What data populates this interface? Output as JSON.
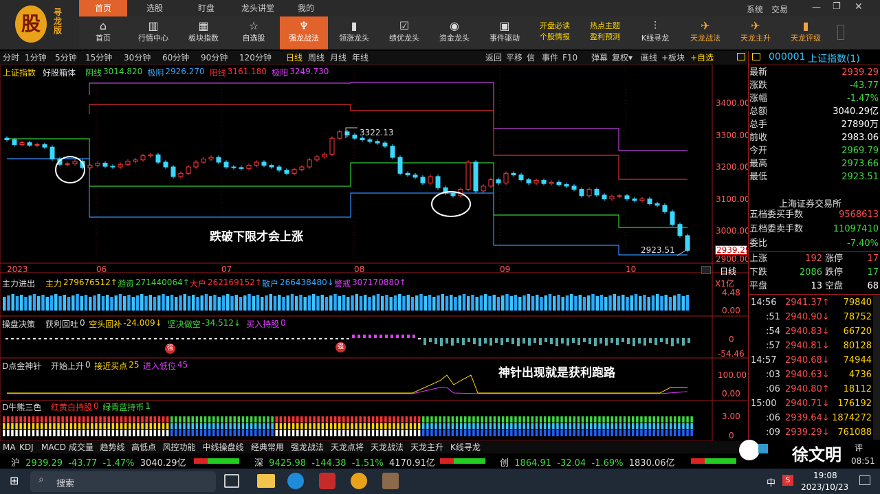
{
  "app": {
    "logo_char": "股",
    "logo_text": "寻龙版",
    "top_nav": [
      "首页",
      "选股",
      "盯盘",
      "龙头讲堂",
      "我的"
    ],
    "top_nav_active": 0,
    "top_right": [
      "系统",
      "交易"
    ],
    "window_controls": [
      "minimize-icon",
      "restore-icon",
      "close-icon"
    ]
  },
  "toolbar": {
    "buttons": [
      {
        "label": "首页",
        "icon": "home-icon"
      },
      {
        "label": "行情中心",
        "icon": "chart-icon"
      },
      {
        "label": "板块指数",
        "icon": "grid-icon"
      },
      {
        "label": "自选股",
        "icon": "star-icon"
      },
      {
        "label": "强龙战法",
        "icon": "dragon-icon",
        "active": true
      },
      {
        "label": "领涨龙头",
        "icon": "bar-icon"
      },
      {
        "label": "绩优龙头",
        "icon": "check-icon"
      },
      {
        "label": "资金龙头",
        "icon": "coin-icon"
      },
      {
        "label": "事件驱动",
        "icon": "event-icon"
      },
      {
        "label_top": "开盘必读",
        "label": "个股情报"
      },
      {
        "label_top": "热点主题",
        "label": "盈利预测"
      },
      {
        "label": "K线寻龙",
        "icon": "kline-icon"
      },
      {
        "label": "天龙战法",
        "icon": "jet-icon",
        "orange": true
      },
      {
        "label": "天龙主升",
        "icon": "jet-icon",
        "orange": true
      },
      {
        "label": "天龙评级",
        "icon": "bar-icon",
        "orange": true
      }
    ]
  },
  "periods": [
    "分时",
    "1分钟",
    "5分钟",
    "15分钟",
    "30分钟",
    "60分钟",
    "90分钟",
    "120分钟",
    "日线",
    "周线",
    "月线",
    "年线"
  ],
  "period_active": "日线",
  "ktools": [
    "返回",
    "平移",
    "信",
    "事件",
    "F10",
    "弹幕",
    "复权▾",
    "画线",
    "+板块",
    "+自选"
  ],
  "main_chart": {
    "title": "上证指数",
    "indicator": "好股箱体",
    "legend": [
      {
        "name": "阴线",
        "value": "3014.820",
        "color": "#3fd83f"
      },
      {
        "name": "极阴",
        "value": "2926.270",
        "color": "#35a8ff"
      },
      {
        "name": "阳线",
        "value": "3161.180",
        "color": "#ff3030"
      },
      {
        "name": "极阳",
        "value": "3249.730",
        "color": "#e03cff"
      }
    ],
    "y_ticks": [
      "3400.00",
      "3300.00",
      "3200.00",
      "3100.00",
      "3000.00"
    ],
    "price_tag": "2939.29",
    "price_tag_low": "2900.00",
    "high_label": "3322.13",
    "low_label": "2923.51",
    "x_labels": [
      "2023",
      "06",
      "07",
      "08",
      "09",
      "10"
    ],
    "annotation": "跌破下限才会上涨",
    "period_tag": "日线"
  },
  "panel_fund": {
    "title": "主力进出",
    "items": [
      {
        "name": "主力",
        "value": "279676512↑",
        "color": "#ffd400"
      },
      {
        "name": "游资",
        "value": "271440064↑",
        "color": "#3fd83f"
      },
      {
        "name": "大户",
        "value": "262169152↑",
        "color": "#ff3030"
      },
      {
        "name": "散户",
        "value": "266438480↓",
        "color": "#35a8ff"
      },
      {
        "name": "警戒",
        "value": "307170880↑",
        "color": "#e03cff"
      }
    ],
    "unit": "X1亿",
    "y_ticks": [
      "4.48",
      "0.00"
    ]
  },
  "panel_ops": {
    "title": "操盘决策",
    "items": [
      {
        "name": "获利回吐",
        "value": "0",
        "color": "#dddddd"
      },
      {
        "name": "空头回补",
        "value": "-24.009↓",
        "color": "#ffd400"
      },
      {
        "name": "坚决做空",
        "value": "-34.512↓",
        "color": "#3fd83f"
      },
      {
        "name": "买入持股",
        "value": "0",
        "color": "#e03cff"
      }
    ],
    "y_ticks": [
      "0",
      "-54.46"
    ],
    "badge": "强"
  },
  "panel_needle": {
    "title": "D点金神针",
    "items": [
      {
        "name": "开始上升",
        "value": "0",
        "color": "#dddddd"
      },
      {
        "name": "接近买点",
        "value": "25",
        "color": "#ffd400"
      },
      {
        "name": "进入低位",
        "value": "45",
        "color": "#e03cff"
      }
    ],
    "y_ticks": [
      "100.00",
      "0.00"
    ],
    "annotation": "神针出现就是获利跑路"
  },
  "panel_bull": {
    "title": "D牛熊三色",
    "items": [
      {
        "name": "红黄白持股",
        "value": "0",
        "color": "#ff3030"
      },
      {
        "name": "绿青蓝持币",
        "value": "1",
        "color": "#3fd83f"
      }
    ],
    "y_ticks": [
      "3.00",
      "0"
    ]
  },
  "bottom_tabs": [
    "MA",
    "KDJ",
    "MACD",
    "成交量",
    "趋势线",
    "高低点",
    "风控功能",
    "中线操盘线",
    "经典常用",
    "强龙战法",
    "天龙点将",
    "天龙战法",
    "天龙主升",
    "K线寻龙"
  ],
  "right_panel": {
    "code": "000001",
    "name": "上证指数(1)",
    "rows": [
      {
        "k": "最新",
        "v": "2939.29",
        "c": "#ff4d4d"
      },
      {
        "k": "涨跌",
        "v": "-43.77",
        "c": "#3fd83f"
      },
      {
        "k": "涨幅",
        "v": "-1.47%",
        "c": "#3fd83f"
      },
      {
        "k": "总额",
        "v": "3040.29亿",
        "c": "#ffffff"
      },
      {
        "k": "总手",
        "v": "27890万",
        "c": "#ffffff"
      },
      {
        "k": "前收",
        "v": "2983.06",
        "c": "#ffffff"
      },
      {
        "k": "今开",
        "v": "2969.79",
        "c": "#3fd83f"
      },
      {
        "k": "最高",
        "v": "2973.66",
        "c": "#3fd83f"
      },
      {
        "k": "最低",
        "v": "2923.51",
        "c": "#3fd83f"
      }
    ],
    "exchange": "上海证券交易所",
    "rows2": [
      {
        "k": "五档委买手数",
        "v": "9568613",
        "c": "#ff4d4d"
      },
      {
        "k": "五档委卖手数",
        "v": "11097410",
        "c": "#3fd83f"
      },
      {
        "k": "委比",
        "v": "-7.40%",
        "c": "#3fd83f"
      }
    ],
    "stats": [
      {
        "k1": "上涨",
        "v1": "192",
        "k2": "涨停",
        "v2": "17",
        "c": "#ff4d4d"
      },
      {
        "k1": "下跌",
        "v1": "2086",
        "k2": "跌停",
        "v2": "17",
        "c": "#3fd83f"
      },
      {
        "k1": "平盘",
        "v1": "13",
        "k2": "空盘",
        "v2": "68",
        "c": "#ffffff"
      }
    ],
    "ticks": [
      {
        "t": "14:56",
        "p": "2941.37↑",
        "q": "79840"
      },
      {
        "t": ":51",
        "p": "2940.90↓",
        "q": "78752"
      },
      {
        "t": ":54",
        "p": "2940.83↓",
        "q": "66720"
      },
      {
        "t": ":57",
        "p": "2940.81↓",
        "q": "80128"
      },
      {
        "t": "14:57",
        "p": "2940.68↓",
        "q": "74944"
      },
      {
        "t": ":03",
        "p": "2940.63↓",
        "q": "4736"
      },
      {
        "t": ":06",
        "p": "2940.80↑",
        "q": "18112"
      },
      {
        "t": "15:00",
        "p": "2940.71↓",
        "q": "176192"
      },
      {
        "t": ":06",
        "p": "2939.64↓",
        "q": "1874272"
      },
      {
        "t": ":09",
        "p": "2939.29↓",
        "q": "761088"
      }
    ],
    "tab_label": "评"
  },
  "status": {
    "sh": {
      "name": "沪",
      "price": "2939.29",
      "chg": "-43.77",
      "pct": "-1.47%",
      "amt": "3040.29亿"
    },
    "sz": {
      "name": "深",
      "price": "9425.98",
      "chg": "-144.38",
      "pct": "-1.51%",
      "amt": "4170.91亿"
    },
    "cy": {
      "name": "创",
      "price": "1864.91",
      "chg": "-32.04",
      "pct": "-1.69%",
      "amt": "1830.06亿"
    },
    "clock": "08:51"
  },
  "watermark": "徐文明",
  "taskbar": {
    "search": "搜索",
    "ime": "中",
    "ime2": "S",
    "time": "19:08",
    "date": "2023/10/23"
  }
}
